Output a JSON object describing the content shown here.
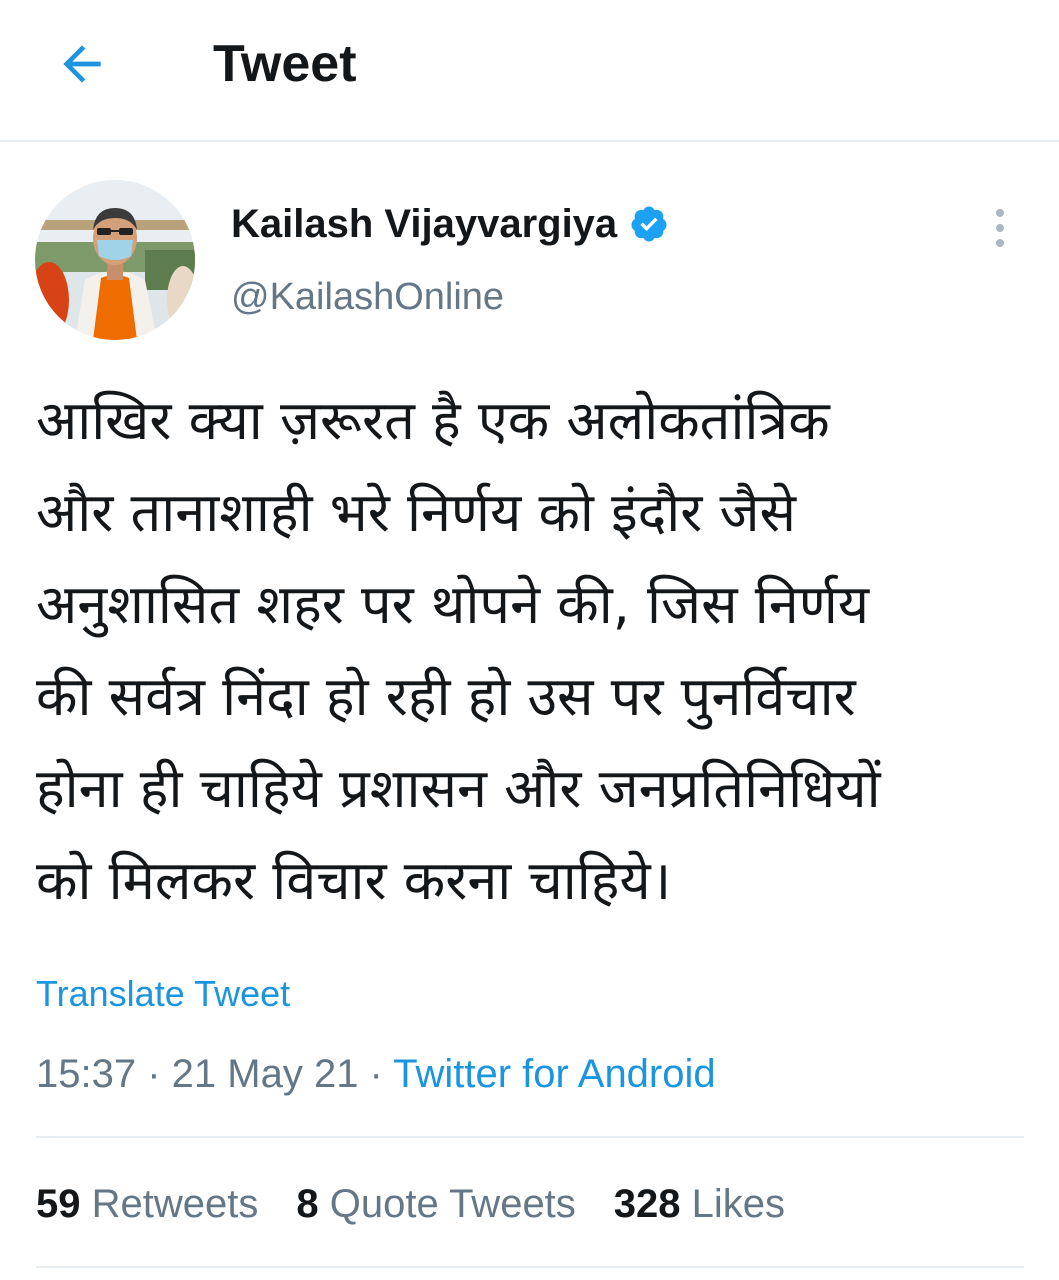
{
  "header": {
    "title": "Tweet",
    "back_icon": "arrow-left-icon"
  },
  "colors": {
    "accent": "#1b95e0",
    "text_primary": "#14171a",
    "text_secondary": "#657786",
    "divider": "#e6ecf0"
  },
  "author": {
    "display_name": "Kailash Vijayvargiya",
    "handle": "@KailashOnline",
    "verified_icon": "verified-badge-icon",
    "more_icon": "more-vertical-icon"
  },
  "tweet": {
    "lines": [
      "आखिर क्या ज़रूरत है एक अलोकतांत्रिक",
      "और तानाशाही भरे निर्णय को इंदौर जैसे",
      "अनुशासित शहर पर थोपने की, जिस निर्णय",
      "की सर्वत्र निंदा हो रही हो उस पर पुनर्विचार",
      "होना ही चाहिये प्रशासन और जनप्रतिनिधियों",
      "को मिलकर विचार करना चाहिये।"
    ],
    "translate_label": "Translate Tweet",
    "time": "15:37",
    "separator": " · ",
    "date": "21 May 21",
    "source": "Twitter for Android"
  },
  "stats": {
    "retweets_count": "59",
    "retweets_label": " Retweets",
    "quotes_count": "8",
    "quotes_label": " Quote Tweets",
    "likes_count": "328",
    "likes_label": " Likes"
  }
}
